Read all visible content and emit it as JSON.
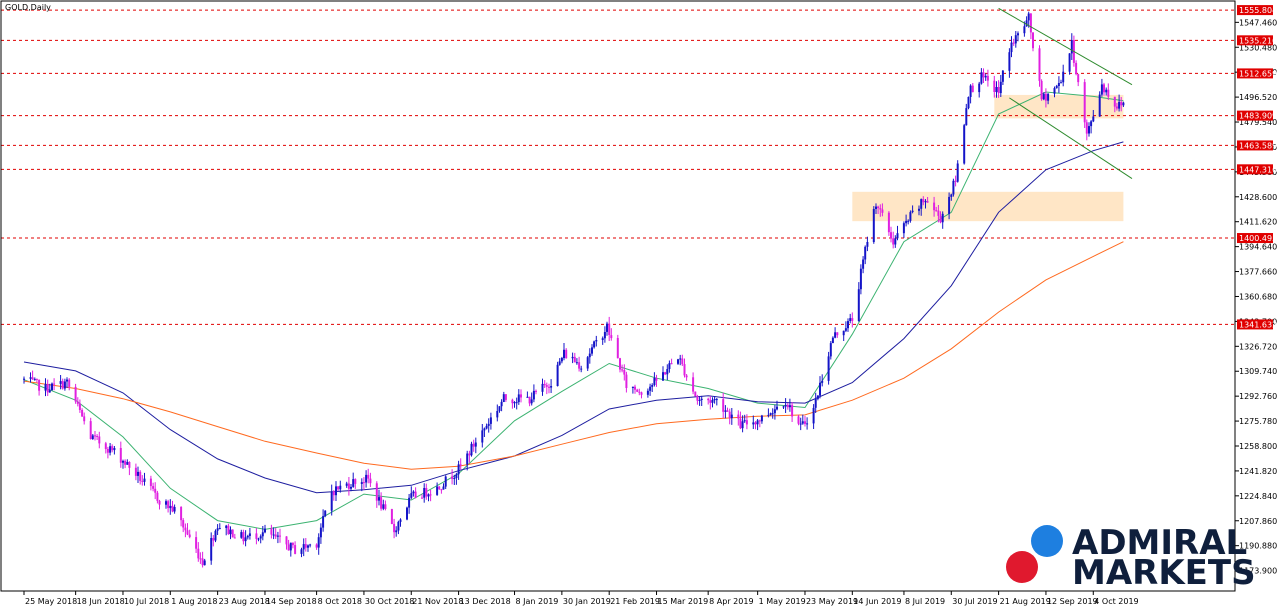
{
  "chart_data": {
    "type": "candlestick",
    "title": "GOLD,Daily",
    "symbol": "GOLD",
    "timeframe": "Daily",
    "ylim": [
      1160,
      1562
    ],
    "y_ticks": [
      "1547.460",
      "1530.480",
      "1513.500",
      "1496.520",
      "1479.540",
      "1462.560",
      "1445.580",
      "1428.600",
      "1411.620",
      "1394.640",
      "1377.660",
      "1360.680",
      "1343.700",
      "1326.720",
      "1309.740",
      "1292.760",
      "1275.780",
      "1258.800",
      "1241.820",
      "1224.840",
      "1207.860",
      "1190.880",
      "1173.900"
    ],
    "x_labels": [
      "25 May 2018",
      "18 Jun 2018",
      "10 Jul 2018",
      "1 Aug 2018",
      "23 Aug 2018",
      "14 Sep 2018",
      "8 Oct 2018",
      "30 Oct 2018",
      "21 Nov 2018",
      "13 Dec 2018",
      "8 Jan 2019",
      "30 Jan 2019",
      "21 Feb 2019",
      "15 Mar 2019",
      "8 Apr 2019",
      "1 May 2019",
      "23 May 2019",
      "14 Jun 2019",
      "8 Jul 2019",
      "30 Jul 2019",
      "21 Aug 2019",
      "12 Sep 2019",
      "4 Oct 2019"
    ],
    "levels": [
      "1555.804",
      "1535.210",
      "1512.659",
      "1483.909",
      "1463.589",
      "1447.316",
      "1400.495",
      "1341.632"
    ],
    "colors": {
      "bull": "#1414c8",
      "bear": "#e020e0",
      "level_line": "#e00000",
      "level_box": "#e00000",
      "ma_fast": "#3cb371",
      "ma_mid": "#1e1ea0",
      "ma_slow": "#ff6a20",
      "channel": "#2e8b2e",
      "zone": "#ffe0b8"
    },
    "zones": [
      {
        "x0": "19 Aug 2019",
        "x1": "18 Oct 2019",
        "y0": 1482,
        "y1": 1498
      },
      {
        "x0": "14 Jun 2019",
        "x1": "18 Oct 2019",
        "y0": 1412,
        "y1": 1432
      }
    ],
    "channel": [
      {
        "p1": [
          "21 Aug 2019",
          1557
        ],
        "p2": [
          "22 Oct 2019",
          1505
        ]
      },
      {
        "p1": [
          "26 Aug 2019",
          1496
        ],
        "p2": [
          "22 Oct 2019",
          1441
        ]
      }
    ],
    "moving_averages": [
      {
        "key": "ma_fast",
        "points": [
          [
            "25 May 2018",
            1304
          ],
          [
            "18 Jun 2018",
            1290
          ],
          [
            "10 Jul 2018",
            1265
          ],
          [
            "1 Aug 2018",
            1230
          ],
          [
            "23 Aug 2018",
            1208
          ],
          [
            "14 Sep 2018",
            1202
          ],
          [
            "8 Oct 2018",
            1208
          ],
          [
            "30 Oct 2018",
            1226
          ],
          [
            "21 Nov 2018",
            1222
          ],
          [
            "13 Dec 2018",
            1240
          ],
          [
            "8 Jan 2019",
            1276
          ],
          [
            "30 Jan 2019",
            1296
          ],
          [
            "21 Feb 2019",
            1315
          ],
          [
            "15 Mar 2019",
            1305
          ],
          [
            "8 Apr 2019",
            1298
          ],
          [
            "1 May 2019",
            1288
          ],
          [
            "23 May 2019",
            1285
          ],
          [
            "14 Jun 2019",
            1335
          ],
          [
            "8 Jul 2019",
            1398
          ],
          [
            "30 Jul 2019",
            1418
          ],
          [
            "21 Aug 2019",
            1485
          ],
          [
            "12 Sep 2019",
            1500
          ],
          [
            "4 Oct 2019",
            1497
          ],
          [
            "18 Oct 2019",
            1494
          ]
        ]
      },
      {
        "key": "ma_mid",
        "points": [
          [
            "25 May 2018",
            1316
          ],
          [
            "18 Jun 2018",
            1310
          ],
          [
            "10 Jul 2018",
            1295
          ],
          [
            "1 Aug 2018",
            1270
          ],
          [
            "23 Aug 2018",
            1250
          ],
          [
            "14 Sep 2018",
            1237
          ],
          [
            "8 Oct 2018",
            1227
          ],
          [
            "30 Oct 2018",
            1229
          ],
          [
            "21 Nov 2018",
            1232
          ],
          [
            "13 Dec 2018",
            1242
          ],
          [
            "8 Jan 2019",
            1252
          ],
          [
            "30 Jan 2019",
            1266
          ],
          [
            "21 Feb 2019",
            1284
          ],
          [
            "15 Mar 2019",
            1290
          ],
          [
            "8 Apr 2019",
            1293
          ],
          [
            "1 May 2019",
            1289
          ],
          [
            "23 May 2019",
            1288
          ],
          [
            "14 Jun 2019",
            1302
          ],
          [
            "8 Jul 2019",
            1332
          ],
          [
            "30 Jul 2019",
            1368
          ],
          [
            "21 Aug 2019",
            1418
          ],
          [
            "12 Sep 2019",
            1447
          ],
          [
            "4 Oct 2019",
            1460
          ],
          [
            "18 Oct 2019",
            1466
          ]
        ]
      },
      {
        "key": "ma_slow",
        "points": [
          [
            "25 May 2018",
            1303
          ],
          [
            "18 Jun 2018",
            1298
          ],
          [
            "10 Jul 2018",
            1291
          ],
          [
            "1 Aug 2018",
            1282
          ],
          [
            "23 Aug 2018",
            1272
          ],
          [
            "14 Sep 2018",
            1262
          ],
          [
            "8 Oct 2018",
            1254
          ],
          [
            "30 Oct 2018",
            1247
          ],
          [
            "21 Nov 2018",
            1243
          ],
          [
            "13 Dec 2018",
            1245
          ],
          [
            "8 Jan 2019",
            1252
          ],
          [
            "30 Jan 2019",
            1260
          ],
          [
            "21 Feb 2019",
            1268
          ],
          [
            "15 Mar 2019",
            1274
          ],
          [
            "8 Apr 2019",
            1277
          ],
          [
            "1 May 2019",
            1279
          ],
          [
            "23 May 2019",
            1280
          ],
          [
            "14 Jun 2019",
            1290
          ],
          [
            "8 Jul 2019",
            1305
          ],
          [
            "30 Jul 2019",
            1325
          ],
          [
            "21 Aug 2019",
            1350
          ],
          [
            "12 Sep 2019",
            1372
          ],
          [
            "4 Oct 2019",
            1388
          ],
          [
            "18 Oct 2019",
            1398
          ]
        ]
      }
    ],
    "anchors": [
      [
        "25 May 2018",
        1304
      ],
      [
        "4 Jun 2018",
        1298
      ],
      [
        "14 Jun 2018",
        1302
      ],
      [
        "25 Jun 2018",
        1265
      ],
      [
        "6 Jul 2018",
        1255
      ],
      [
        "16 Jul 2018",
        1240
      ],
      [
        "27 Jul 2018",
        1222
      ],
      [
        "3 Aug 2018",
        1215
      ],
      [
        "16 Aug 2018",
        1180
      ],
      [
        "23 Aug 2018",
        1205
      ],
      [
        "4 Sep 2018",
        1196
      ],
      [
        "14 Sep 2018",
        1200
      ],
      [
        "28 Sep 2018",
        1188
      ],
      [
        "8 Oct 2018",
        1193
      ],
      [
        "15 Oct 2018",
        1228
      ],
      [
        "26 Oct 2018",
        1235
      ],
      [
        "1 Nov 2018",
        1236
      ],
      [
        "13 Nov 2018",
        1201
      ],
      [
        "21 Nov 2018",
        1224
      ],
      [
        "3 Dec 2018",
        1230
      ],
      [
        "13 Dec 2018",
        1243
      ],
      [
        "21 Dec 2018",
        1262
      ],
      [
        "3 Jan 2019",
        1291
      ],
      [
        "15 Jan 2019",
        1291
      ],
      [
        "25 Jan 2019",
        1303
      ],
      [
        "31 Jan 2019",
        1322
      ],
      [
        "8 Feb 2019",
        1314
      ],
      [
        "20 Feb 2019",
        1340
      ],
      [
        "1 Mar 2019",
        1300
      ],
      [
        "8 Mar 2019",
        1296
      ],
      [
        "15 Mar 2019",
        1303
      ],
      [
        "25 Mar 2019",
        1320
      ],
      [
        "3 Apr 2019",
        1290
      ],
      [
        "12 Apr 2019",
        1290
      ],
      [
        "23 Apr 2019",
        1273
      ],
      [
        "2 May 2019",
        1277
      ],
      [
        "14 May 2019",
        1290
      ],
      [
        "21 May 2019",
        1271
      ],
      [
        "27 May 2019",
        1284
      ],
      [
        "5 Jun 2019",
        1333
      ],
      [
        "14 Jun 2019",
        1345
      ],
      [
        "21 Jun 2019",
        1400
      ],
      [
        "25 Jun 2019",
        1425
      ],
      [
        "3 Jul 2019",
        1398
      ],
      [
        "11 Jul 2019",
        1415
      ],
      [
        "18 Jul 2019",
        1427
      ],
      [
        "25 Jul 2019",
        1414
      ],
      [
        "1 Aug 2019",
        1440
      ],
      [
        "7 Aug 2019",
        1500
      ],
      [
        "13 Aug 2019",
        1510
      ],
      [
        "21 Aug 2019",
        1500
      ],
      [
        "26 Aug 2019",
        1530
      ],
      [
        "4 Sep 2019",
        1550
      ],
      [
        "10 Sep 2019",
        1495
      ],
      [
        "18 Sep 2019",
        1505
      ],
      [
        "24 Sep 2019",
        1532
      ],
      [
        "1 Oct 2019",
        1470
      ],
      [
        "8 Oct 2019",
        1505
      ],
      [
        "15 Oct 2019",
        1490
      ],
      [
        "18 Oct 2019",
        1493
      ]
    ]
  },
  "logo": {
    "line1": "ADMIRAL",
    "line2": "MARKETS",
    "colors": {
      "dot_blue": "#1e7fe0",
      "dot_red": "#e0192e",
      "text": "#0f1f3c"
    }
  }
}
